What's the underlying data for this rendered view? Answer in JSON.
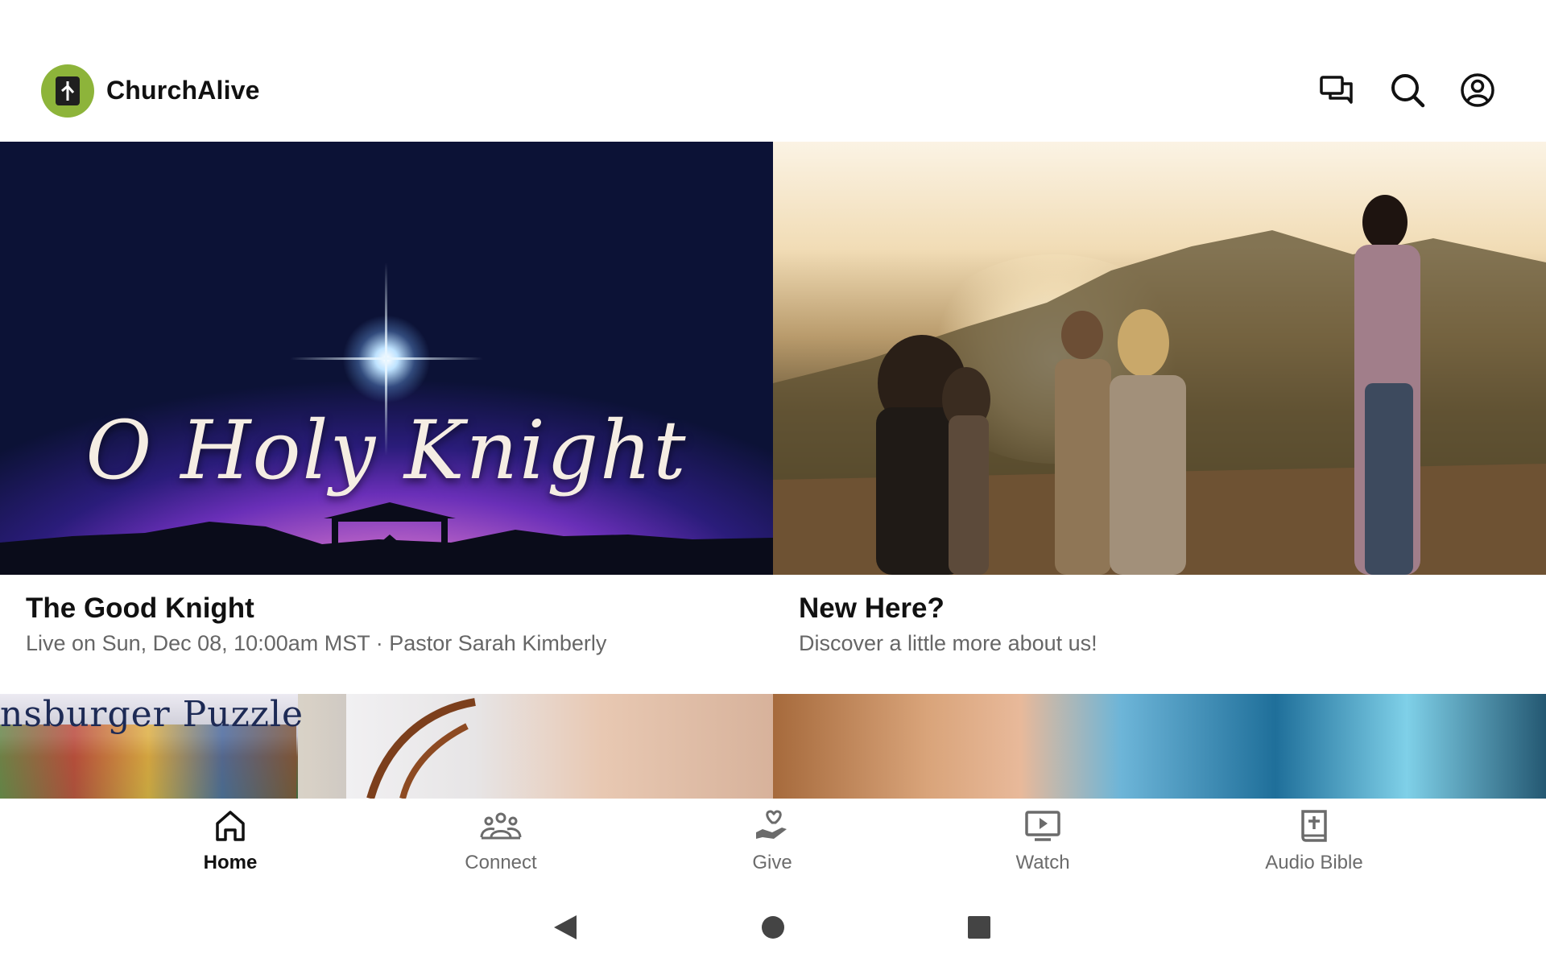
{
  "app": {
    "title": "ChurchAlive",
    "accent_color": "#8db43a"
  },
  "header": {
    "icons": [
      "chat-icon",
      "search-icon",
      "account-icon"
    ]
  },
  "cards": [
    {
      "image_text": "O Holy Knight",
      "title": "The Good Knight",
      "subtitle": "Live on Sun, Dec 08, 10:00am MST · Pastor Sarah Kimberly"
    },
    {
      "title": "New Here?",
      "subtitle": "Discover a little more about us!"
    }
  ],
  "peek": {
    "left_text": "nsburger Puzzle"
  },
  "bottom_nav": {
    "items": [
      {
        "label": "Home",
        "icon": "home-icon",
        "active": true
      },
      {
        "label": "Connect",
        "icon": "group-icon",
        "active": false
      },
      {
        "label": "Give",
        "icon": "give-hand-heart-icon",
        "active": false
      },
      {
        "label": "Watch",
        "icon": "play-screen-icon",
        "active": false
      },
      {
        "label": "Audio Bible",
        "icon": "bible-icon",
        "active": false
      }
    ]
  },
  "system_nav": [
    "back-icon",
    "home-circle-icon",
    "recents-icon"
  ]
}
